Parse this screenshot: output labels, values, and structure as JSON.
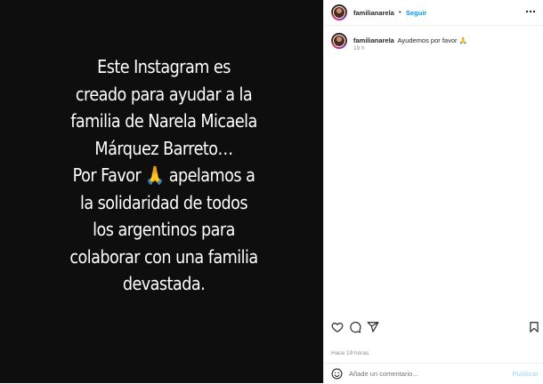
{
  "post": {
    "caption_lines": [
      "Este Instagram es",
      "creado para ayudar a la",
      "familia de Narela Micaela",
      "Márquez Barreto…",
      "Por Favor 🙏 apelamos a",
      "la solidaridad de todos",
      "los argentinos para",
      "colaborar con una familia",
      "devastada."
    ]
  },
  "header": {
    "username": "familianarela",
    "separator": "•",
    "follow_label": "Seguir"
  },
  "comment": {
    "username": "familianarela",
    "text": "Ayudemos por favor 🙏",
    "time": "19 h"
  },
  "actions": {
    "icons": [
      "heart-icon",
      "comment-icon",
      "share-icon",
      "bookmark-icon"
    ]
  },
  "footer": {
    "posted": "Hace 19 horas",
    "comment_placeholder": "Añade un comentario...",
    "publish_label": "Publicar"
  },
  "colors": {
    "image_background": "#0e0e0e",
    "link_blue": "#0095f6",
    "publish_disabled": "#b2dffc"
  }
}
